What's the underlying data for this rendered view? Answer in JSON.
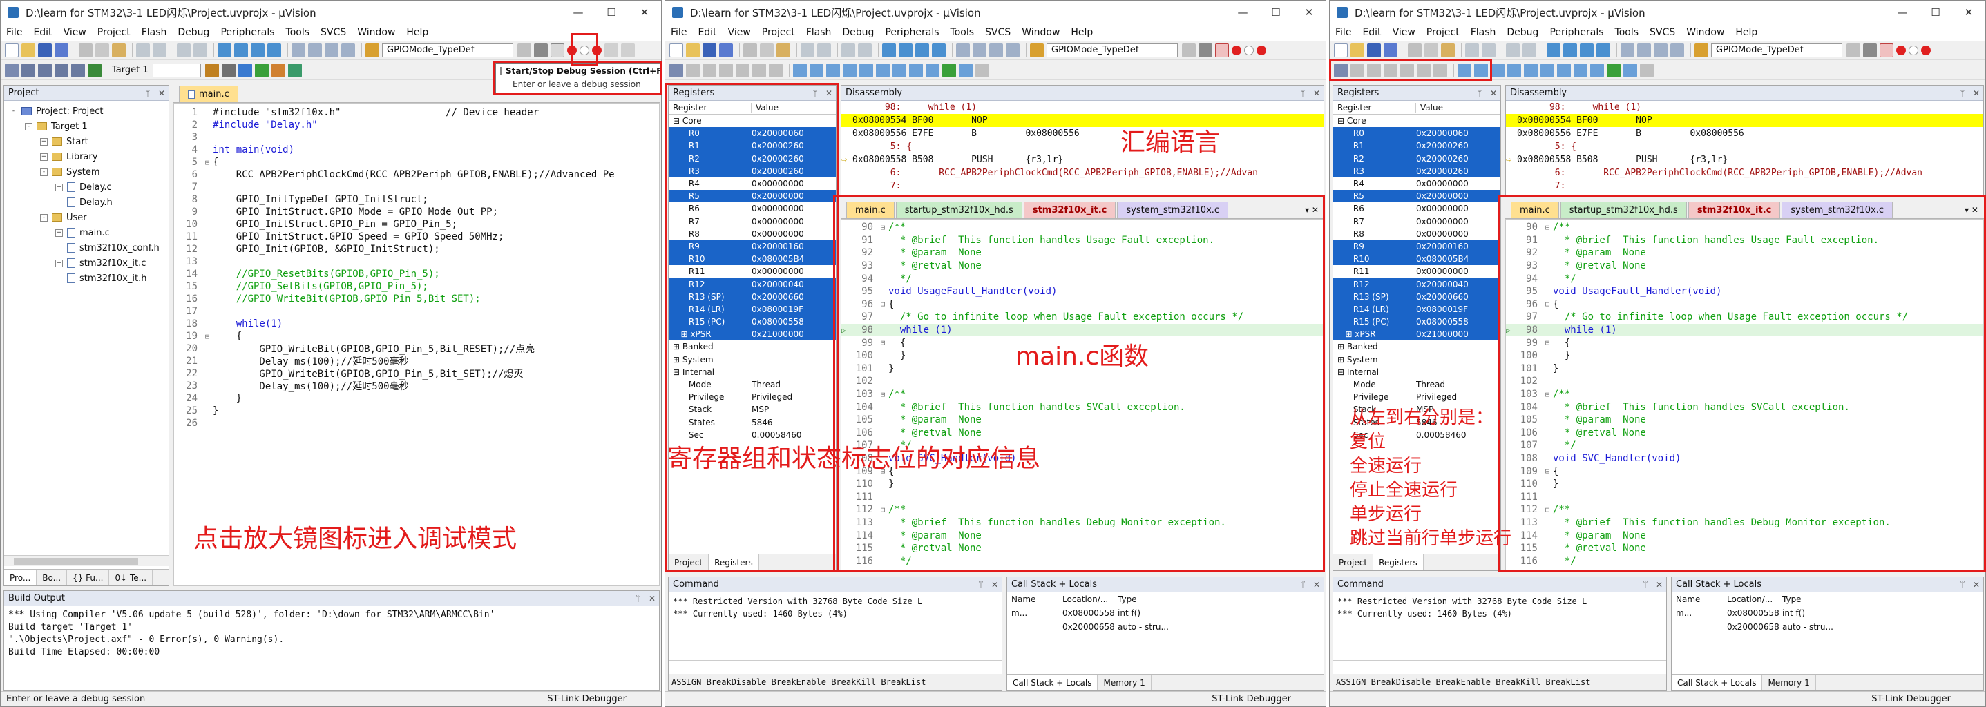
{
  "windows": [
    {
      "title": "D:\\learn for STM32\\3-1 LED闪烁\\Project.uvprojx - µVision",
      "mode": "edit"
    },
    {
      "title": "D:\\learn for STM32\\3-1 LED闪烁\\Project.uvprojx - µVision",
      "mode": "debug"
    },
    {
      "title": "D:\\learn for STM32\\3-1 LED闪烁\\Project.uvprojx - µVision",
      "mode": "debug"
    }
  ],
  "window_controls": [
    "—",
    "☐",
    "✕"
  ],
  "menu": [
    "File",
    "Edit",
    "View",
    "Project",
    "Flash",
    "Debug",
    "Peripherals",
    "Tools",
    "SVCS",
    "Window",
    "Help"
  ],
  "toolbar": {
    "combo_value": "GPIOMode_TypeDef",
    "target_value": "Target 1"
  },
  "tooltip": {
    "title": "Start/Stop Debug Session (Ctrl+F5)",
    "desc": "Enter or leave a debug session"
  },
  "project_panel": {
    "title": "Project",
    "tree": [
      {
        "label": "Project: Project",
        "level": 0,
        "kind": "proj",
        "exp": "-"
      },
      {
        "label": "Target 1",
        "level": 1,
        "kind": "folder",
        "exp": "-"
      },
      {
        "label": "Start",
        "level": 2,
        "kind": "folder",
        "exp": "+"
      },
      {
        "label": "Library",
        "level": 2,
        "kind": "folder",
        "exp": "+"
      },
      {
        "label": "System",
        "level": 2,
        "kind": "folder",
        "exp": "-"
      },
      {
        "label": "Delay.c",
        "level": 3,
        "kind": "file",
        "exp": "+"
      },
      {
        "label": "Delay.h",
        "level": 3,
        "kind": "file",
        "exp": ""
      },
      {
        "label": "User",
        "level": 2,
        "kind": "folder",
        "exp": "-"
      },
      {
        "label": "main.c",
        "level": 3,
        "kind": "file",
        "exp": "+"
      },
      {
        "label": "stm32f10x_conf.h",
        "level": 3,
        "kind": "file",
        "exp": ""
      },
      {
        "label": "stm32f10x_it.c",
        "level": 3,
        "kind": "file",
        "exp": "+"
      },
      {
        "label": "stm32f10x_it.h",
        "level": 3,
        "kind": "file",
        "exp": ""
      }
    ],
    "bottom_tabs": [
      "Pro...",
      "Bo...",
      "{} Fu...",
      "0↓ Te..."
    ]
  },
  "editor1": {
    "tab": "main.c",
    "lines": [
      {
        "n": "1",
        "f": "",
        "t": "#include \"stm32f10x.h\"                  // Device header"
      },
      {
        "n": "2",
        "f": "",
        "t": "#include \"Delay.h\""
      },
      {
        "n": "3",
        "f": "",
        "t": ""
      },
      {
        "n": "4",
        "f": "",
        "t": "int main(void)"
      },
      {
        "n": "5",
        "f": "⊟",
        "t": "{"
      },
      {
        "n": "6",
        "f": "",
        "t": "    RCC_APB2PeriphClockCmd(RCC_APB2Periph_GPIOB,ENABLE);//Advanced Pe"
      },
      {
        "n": "7",
        "f": "",
        "t": ""
      },
      {
        "n": "8",
        "f": "",
        "t": "    GPIO_InitTypeDef GPIO_InitStruct;"
      },
      {
        "n": "9",
        "f": "",
        "t": "    GPIO_InitStruct.GPIO_Mode = GPIO_Mode_Out_PP;"
      },
      {
        "n": "10",
        "f": "",
        "t": "    GPIO_InitStruct.GPIO_Pin = GPIO_Pin_5;"
      },
      {
        "n": "11",
        "f": "",
        "t": "    GPIO_InitStruct.GPIO_Speed = GPIO_Speed_50MHz;"
      },
      {
        "n": "12",
        "f": "",
        "t": "    GPIO_Init(GPIOB, &GPIO_InitStruct);"
      },
      {
        "n": "13",
        "f": "",
        "t": ""
      },
      {
        "n": "14",
        "f": "",
        "t": "    //GPIO_ResetBits(GPIOB,GPIO_Pin_5);"
      },
      {
        "n": "15",
        "f": "",
        "t": "    //GPIO_SetBits(GPIOB,GPIO_Pin_5);"
      },
      {
        "n": "16",
        "f": "",
        "t": "    //GPIO_WriteBit(GPIOB,GPIO_Pin_5,Bit_SET);"
      },
      {
        "n": "17",
        "f": "",
        "t": ""
      },
      {
        "n": "18",
        "f": "",
        "t": "    while(1)"
      },
      {
        "n": "19",
        "f": "⊟",
        "t": "    {"
      },
      {
        "n": "20",
        "f": "",
        "t": "        GPIO_WriteBit(GPIOB,GPIO_Pin_5,Bit_RESET);//点亮"
      },
      {
        "n": "21",
        "f": "",
        "t": "        Delay_ms(100);//延时500毫秒"
      },
      {
        "n": "22",
        "f": "",
        "t": "        GPIO_WriteBit(GPIOB,GPIO_Pin_5,Bit_SET);//熄灭"
      },
      {
        "n": "23",
        "f": "",
        "t": "        Delay_ms(100);//延时500毫秒"
      },
      {
        "n": "24",
        "f": "",
        "t": "    }"
      },
      {
        "n": "25",
        "f": "",
        "t": "}"
      },
      {
        "n": "26",
        "f": "",
        "t": ""
      }
    ]
  },
  "build_output": {
    "title": "Build Output",
    "lines": [
      "*** Using Compiler 'V5.06 update 5 (build 528)', folder: 'D:\\down for STM32\\ARM\\ARMCC\\Bin'",
      "Build target 'Target 1'",
      "\".\\Objects\\Project.axf\" - 0 Error(s), 0 Warning(s).",
      "Build Time Elapsed:  00:00:00"
    ]
  },
  "status": {
    "left": "Enter or leave a debug session",
    "right": "ST-Link Debugger"
  },
  "registers": {
    "title": "Registers",
    "col_register": "Register",
    "col_value": "Value",
    "rows": [
      {
        "n": "⊟ Core",
        "v": "",
        "sel": false
      },
      {
        "n": "      R0",
        "v": "0x20000060",
        "sel": true
      },
      {
        "n": "      R1",
        "v": "0x20000260",
        "sel": true
      },
      {
        "n": "      R2",
        "v": "0x20000260",
        "sel": true
      },
      {
        "n": "      R3",
        "v": "0x20000260",
        "sel": true
      },
      {
        "n": "      R4",
        "v": "0x00000000",
        "sel": false
      },
      {
        "n": "      R5",
        "v": "0x20000000",
        "sel": true
      },
      {
        "n": "      R6",
        "v": "0x00000000",
        "sel": false
      },
      {
        "n": "      R7",
        "v": "0x00000000",
        "sel": false
      },
      {
        "n": "      R8",
        "v": "0x00000000",
        "sel": false
      },
      {
        "n": "      R9",
        "v": "0x20000160",
        "sel": true
      },
      {
        "n": "      R10",
        "v": "0x080005B4",
        "sel": true
      },
      {
        "n": "      R11",
        "v": "0x00000000",
        "sel": false
      },
      {
        "n": "      R12",
        "v": "0x20000040",
        "sel": true
      },
      {
        "n": "      R13 (SP)",
        "v": "0x20000660",
        "sel": true
      },
      {
        "n": "      R14 (LR)",
        "v": "0x0800019F",
        "sel": true
      },
      {
        "n": "      R15 (PC)",
        "v": "0x08000558",
        "sel": true
      },
      {
        "n": "   ⊞ xPSR",
        "v": "0x21000000",
        "sel": true
      },
      {
        "n": "⊞ Banked",
        "v": "",
        "sel": false
      },
      {
        "n": "⊞ System",
        "v": "",
        "sel": false
      },
      {
        "n": "⊟ Internal",
        "v": "",
        "sel": false
      },
      {
        "n": "      Mode",
        "v": "Thread",
        "sel": false
      },
      {
        "n": "      Privilege",
        "v": "Privileged",
        "sel": false
      },
      {
        "n": "      Stack",
        "v": "MSP",
        "sel": false
      },
      {
        "n": "      States",
        "v": "5846",
        "sel": false
      },
      {
        "n": "      Sec",
        "v": "0.00058460",
        "sel": false
      }
    ],
    "bottom_tabs": [
      "Project",
      "Registers"
    ]
  },
  "disassembly": {
    "title": "Disassembly",
    "lines": [
      {
        "t": "      98:     while (1)",
        "hl": false,
        "arrow": false,
        "src": true
      },
      {
        "t": "0x08000554 BF00       NOP",
        "hl": true,
        "arrow": false,
        "src": false
      },
      {
        "t": "0x08000556 E7FE       B         0x08000556",
        "hl": false,
        "arrow": false,
        "src": false
      },
      {
        "t": "       5: {",
        "hl": false,
        "arrow": false,
        "src": true
      },
      {
        "t": "0x08000558 B508       PUSH      {r3,lr}",
        "hl": false,
        "arrow": true,
        "src": false
      },
      {
        "t": "       6:       RCC_APB2PeriphClockCmd(RCC_APB2Periph_GPIOB,ENABLE);//Advan",
        "hl": false,
        "arrow": false,
        "src": true
      },
      {
        "t": "       7:",
        "hl": false,
        "arrow": false,
        "src": true
      }
    ]
  },
  "editor2": {
    "tabs": [
      "main.c",
      "startup_stm32f10x_hd.s",
      "stm32f10x_it.c",
      "system_stm32f10x.c"
    ],
    "lines": [
      {
        "n": "90",
        "f": "⊟",
        "t": "/**"
      },
      {
        "n": "91",
        "f": "",
        "t": "  * @brief  This function handles Usage Fault exception."
      },
      {
        "n": "92",
        "f": "",
        "t": "  * @param  None"
      },
      {
        "n": "93",
        "f": "",
        "t": "  * @retval None"
      },
      {
        "n": "94",
        "f": "",
        "t": "  */"
      },
      {
        "n": "95",
        "f": "",
        "t": "void UsageFault_Handler(void)"
      },
      {
        "n": "96",
        "f": "⊟",
        "t": "{"
      },
      {
        "n": "97",
        "f": "",
        "t": "  /* Go to infinite loop when Usage Fault exception occurs */"
      },
      {
        "n": "98",
        "f": "",
        "t": "  while (1)"
      },
      {
        "n": "99",
        "f": "⊟",
        "t": "  {"
      },
      {
        "n": "100",
        "f": "",
        "t": "  }"
      },
      {
        "n": "101",
        "f": "",
        "t": "}"
      },
      {
        "n": "102",
        "f": "",
        "t": ""
      },
      {
        "n": "103",
        "f": "⊟",
        "t": "/**"
      },
      {
        "n": "104",
        "f": "",
        "t": "  * @brief  This function handles SVCall exception."
      },
      {
        "n": "105",
        "f": "",
        "t": "  * @param  None"
      },
      {
        "n": "106",
        "f": "",
        "t": "  * @retval None"
      },
      {
        "n": "107",
        "f": "",
        "t": "  */"
      },
      {
        "n": "108",
        "f": "",
        "t": "void SVC_Handler(void)"
      },
      {
        "n": "109",
        "f": "⊟",
        "t": "{"
      },
      {
        "n": "110",
        "f": "",
        "t": "}"
      },
      {
        "n": "111",
        "f": "",
        "t": ""
      },
      {
        "n": "112",
        "f": "⊟",
        "t": "/**"
      },
      {
        "n": "113",
        "f": "",
        "t": "  * @brief  This function handles Debug Monitor exception."
      },
      {
        "n": "114",
        "f": "",
        "t": "  * @param  None"
      },
      {
        "n": "115",
        "f": "",
        "t": "  * @retval None"
      },
      {
        "n": "116",
        "f": "",
        "t": "  */"
      }
    ]
  },
  "command": {
    "title": "Command",
    "lines": [
      "*** Restricted Version with 32768 Byte Code Size L",
      "*** Currently used: 1460 Bytes (4%)"
    ],
    "bar": "ASSIGN BreakDisable BreakEnable BreakKill BreakList"
  },
  "callstack": {
    "title": "Call Stack + Locals",
    "cols": [
      "Name",
      "Location/...",
      "Type"
    ],
    "rows": [
      {
        "name": "m...",
        "loc": "0x08000558",
        "type": "int f()"
      },
      {
        "name": "",
        "loc": "0x20000658",
        "type": "auto - stru..."
      }
    ],
    "tabs": [
      "Call Stack + Locals",
      "Memory 1"
    ]
  },
  "annotations": {
    "enter_debug": "点击放大镜图标进入调试模式",
    "assembly": "汇编语言",
    "registers": "寄存器组和状态标志位的对应信息",
    "mainc": "main.c函数",
    "buttons_title": "从左到右分别是：",
    "buttons": [
      "复位",
      "全速运行",
      "停止全速运行",
      "单步运行",
      "跳过当前行单步运行"
    ]
  }
}
